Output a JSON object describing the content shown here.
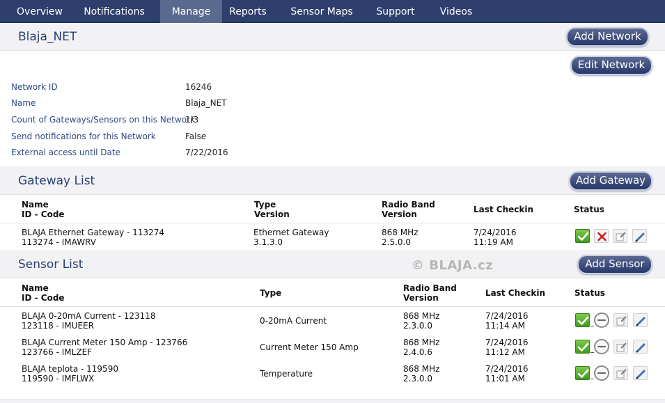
{
  "nav": {
    "items": [
      {
        "label": "Overview"
      },
      {
        "label": "Notifications"
      },
      {
        "label": "Manage"
      },
      {
        "label": "Reports"
      },
      {
        "label": "Sensor Maps"
      },
      {
        "label": "Support"
      },
      {
        "label": "Videos"
      }
    ],
    "active": "Manage"
  },
  "network": {
    "title": "Blaja_NET",
    "add_network_label": "Add Network",
    "edit_network_label": "Edit Network",
    "details": [
      {
        "label": "Network ID",
        "value": "16246"
      },
      {
        "label": "Name",
        "value": "Blaja_NET"
      },
      {
        "label": "Count of Gateways/Sensors on this Network",
        "value": "1/3"
      },
      {
        "label": "Send notifications for this Network",
        "value": "False"
      },
      {
        "label": "External access until Date",
        "value": "7/22/2016"
      }
    ]
  },
  "gateways": {
    "title": "Gateway List",
    "add_label": "Add Gateway",
    "columns": {
      "name": "Name",
      "id_code": "ID - Code",
      "type": "Type",
      "version": "Version",
      "radio_band": "Radio Band",
      "radio_version": "Version",
      "last_checkin": "Last Checkin",
      "status": "Status"
    },
    "rows": [
      {
        "name": "BLAJA Ethernet Gateway - 113274",
        "id_code": "113274 - IMAWRV",
        "type": "Ethernet Gateway",
        "version": "3.1.3.0",
        "radio_band": "868 MHz",
        "radio_version": "2.5.0.0",
        "checkin_date": "7/24/2016",
        "checkin_time": "11:19 AM"
      }
    ]
  },
  "sensors": {
    "title": "Sensor List",
    "add_label": "Add Sensor",
    "columns": {
      "name": "Name",
      "id_code": "ID - Code",
      "type": "Type",
      "radio_band": "Radio Band",
      "radio_version": "Version",
      "last_checkin": "Last Checkin",
      "status": "Status"
    },
    "rows": [
      {
        "name": "BLAJA 0-20mA Current - 123118",
        "id_code": "123118 - IMUEER",
        "type": "0-20mA Current",
        "radio_band": "868 MHz",
        "radio_version": "2.3.0.0",
        "checkin_date": "7/24/2016",
        "checkin_time": "11:14 AM"
      },
      {
        "name": "BLAJA Current Meter 150 Amp - 123766",
        "id_code": "123766 - IMLZEF",
        "type": "Current Meter 150 Amp",
        "radio_band": "868 MHz",
        "radio_version": "2.4.0.6",
        "checkin_date": "7/24/2016",
        "checkin_time": "11:12 AM"
      },
      {
        "name": "BLAJA teplota - 119590",
        "id_code": "119590 - IMFLWX",
        "type": "Temperature",
        "radio_band": "868 MHz",
        "radio_version": "2.3.0.0",
        "checkin_date": "7/24/2016",
        "checkin_time": "11:01 AM"
      }
    ]
  },
  "watermark": "© BLAJA.cz",
  "icons": {
    "active": "checkmark-icon",
    "gateway_remove": "red-x-icon",
    "sensor_inactive": "minus-circle-icon",
    "settings": "edit-settings-icon",
    "edit": "pencil-icon"
  },
  "colors": {
    "nav_bg": "#2e3f6e",
    "nav_active": "#5a6a8e",
    "title_blue": "#2a3f77",
    "label_blue": "#2e4a87",
    "ok_green": "#4caf2a",
    "remove_red": "#cc1b1b"
  }
}
